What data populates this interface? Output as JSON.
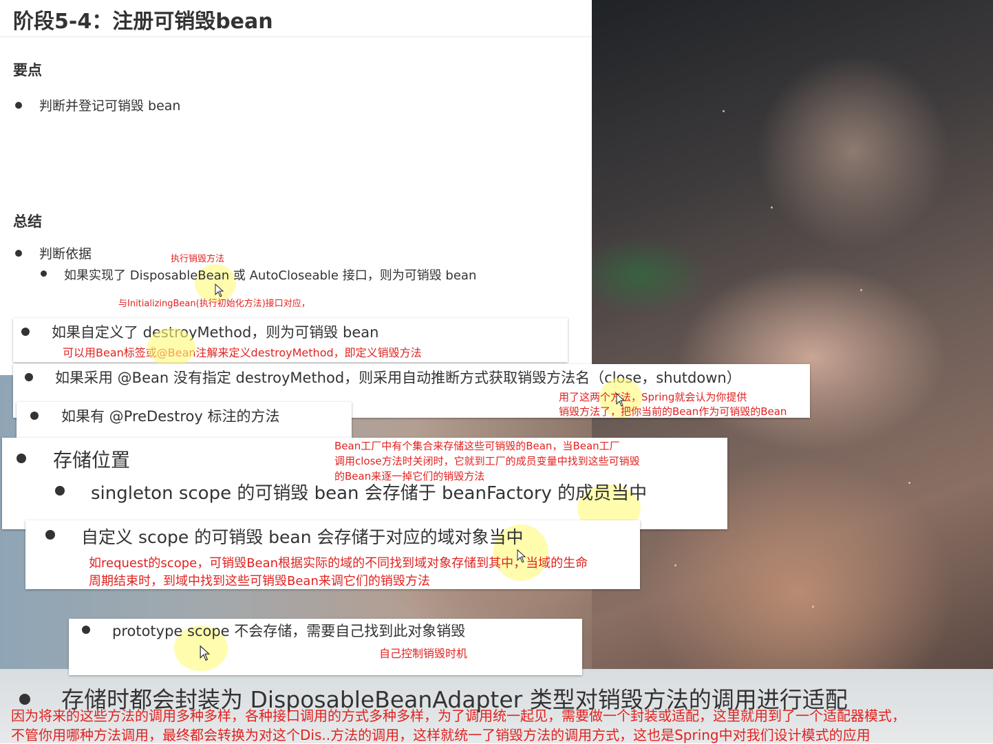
{
  "title": "阶段5-4：注册可销毁bean",
  "sections": {
    "key_points_heading": "要点",
    "key_point_1": "判断并登记可销毁 bean",
    "summary_heading": "总结",
    "basis": "判断依据",
    "basis_1": "如果实现了 DisposableBean 或 AutoCloseable 接口，则为可销毁 bean",
    "basis_2": "如果自定义了 destroyMethod，则为可销毁 bean",
    "basis_3": "如果采用 @Bean 没有指定 destroyMethod，则采用自动推断方式获取销毁方法名（close，shutdown）",
    "basis_4": "如果有 @PreDestroy 标注的方法",
    "storage": "存储位置",
    "storage_1": "singleton scope 的可销毁 bean 会存储于 beanFactory 的成员当中",
    "storage_2": "自定义 scope 的可销毁 bean 会存储于对应的域对象当中",
    "storage_3": "prototype scope 不会存储，需要自己找到此对象销毁",
    "adapter": "存储时都会封装为 DisposableBeanAdapter 类型对销毁方法的调用进行适配"
  },
  "annotations": {
    "exec_destroy": "执行销毁方法",
    "initializing": "与InitializingBean(执行初始化方法)接口对应，",
    "define_destroy": "可以用Bean标签或@Bean注解来定义destroyMethod，即定义销毁方法",
    "two_methods_1": "用了这两个方法，Spring就会认为你提供",
    "two_methods_2": "销毁方法了，把你当前的Bean作为可销毁的Bean",
    "factory_1": "Bean工厂中有个集合来存储这些可销毁的Bean，当Bean工厂",
    "factory_2": "调用close方法时关闭时，它就到工厂的成员变量中找到这些可销毁",
    "factory_3": "的Bean来逐一掉它们的销毁方法",
    "request_1": "如request的scope，可销毁Bean根据实际的域的不同找到域对象存储到其中，当域的生命",
    "request_2": "周期结束时，到域中找到这些可销毁Bean来调它们的销毁方法",
    "self_control": "自己控制销毁时机",
    "adapter_1": "因为将来的这些方法的调用多种多样，各种接口调用的方式多种多样，为了调用统一起见，需要做一个封装或适配，这里就用到了一个适配器模式，",
    "adapter_2": "不管你用哪种方法调用，最终都会转换为对这个Dis..方法的调用，这样就统一了销毁方法的调用方式，这也是Spring中对我们设计模式的应用"
  },
  "icons": [
    "mouse-cursor-icon",
    "bullet-icon"
  ],
  "colors": {
    "annotation": "#e0221f",
    "text": "#333333",
    "highlight": "#fff878"
  }
}
